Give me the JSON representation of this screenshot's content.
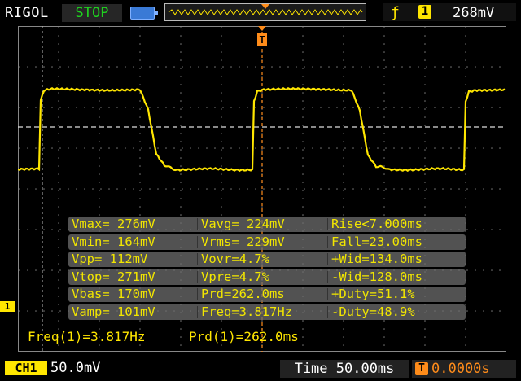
{
  "header": {
    "brand": "RIGOL",
    "run_state": "STOP",
    "trigger_channel": "1",
    "trigger_level": "268mV"
  },
  "measurements": {
    "rows": [
      [
        "Vmax= 276mV",
        "Vavg= 224mV",
        "Rise<7.000ms"
      ],
      [
        "Vmin= 164mV",
        "Vrms= 229mV",
        "Fall=23.00ms"
      ],
      [
        "Vpp= 112mV",
        "Vovr=4.7%",
        "+Wid=134.0ms"
      ],
      [
        "Vtop= 271mV",
        "Vpre=4.7%",
        "-Wid=128.0ms"
      ],
      [
        "Vbas= 170mV",
        "Prd=262.0ms",
        "+Duty=51.1%"
      ],
      [
        "Vamp= 101mV",
        "Freq=3.817Hz",
        "-Duty=48.9%"
      ]
    ]
  },
  "readouts": {
    "freq": "Freq(1)=3.817Hz",
    "prd": "Prd(1)=262.0ms"
  },
  "footer": {
    "channel": "CH1",
    "volts_div": "50.0mV",
    "timebase": "Time 50.00ms",
    "trigger_offset": "0.0000s"
  },
  "markers": {
    "channel_marker": "1",
    "trigger_marker": "T"
  },
  "colors": {
    "trace": "#ffe600",
    "trigger": "#ff8c1a",
    "stop": "#1fd11f"
  },
  "icons": [
    "battery-icon",
    "rising-edge-icon",
    "trigger-position-icon"
  ]
}
